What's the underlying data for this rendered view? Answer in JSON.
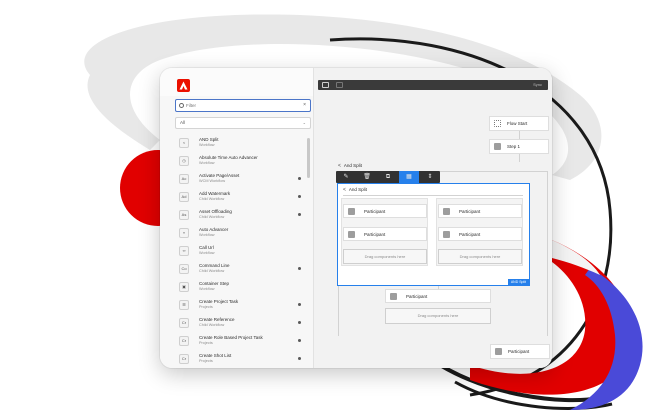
{
  "colors": {
    "accent": "#2680eb",
    "brand": "#eb1000",
    "backdrop_blue": "#4a4ad8",
    "backdrop_red": "#e10000"
  },
  "left_panel": {
    "filter_placeholder": "Filter",
    "filter_clear": "×",
    "select_value": "All",
    "components": [
      {
        "title": "AND Split",
        "subtitle": "Workflow",
        "icon": "split-icon",
        "icon_glyph": "<",
        "dot": false
      },
      {
        "title": "Absolute Time Auto Advancer",
        "subtitle": "Workflow",
        "icon": "clock-icon",
        "icon_glyph": "◷",
        "dot": false
      },
      {
        "title": "Activate Page/Asset",
        "subtitle": "WCM Workflow",
        "icon": "activate-icon",
        "icon_glyph": "Ac",
        "dot": true
      },
      {
        "title": "Add Watermark",
        "subtitle": "Child Workflow",
        "icon": "watermark-icon",
        "icon_glyph": "Ad",
        "dot": true
      },
      {
        "title": "Asset Offloading",
        "subtitle": "Child Workflow",
        "icon": "offload-icon",
        "icon_glyph": "As",
        "dot": true
      },
      {
        "title": "Auto Advancer",
        "subtitle": "Workflow",
        "icon": "advance-icon",
        "icon_glyph": "»",
        "dot": false
      },
      {
        "title": "Call Url",
        "subtitle": "Workflow",
        "icon": "link-icon",
        "icon_glyph": "∞",
        "dot": false
      },
      {
        "title": "Command Line",
        "subtitle": "Child Workflow",
        "icon": "command-icon",
        "icon_glyph": "Co",
        "dot": true
      },
      {
        "title": "Container Step",
        "subtitle": "Workflow",
        "icon": "container-icon",
        "icon_glyph": "▣",
        "dot": false
      },
      {
        "title": "Create Project Task",
        "subtitle": "Projects",
        "icon": "task-icon",
        "icon_glyph": "☰",
        "dot": true
      },
      {
        "title": "Create Reference",
        "subtitle": "Child Workflow",
        "icon": "reference-icon",
        "icon_glyph": "Cr",
        "dot": true
      },
      {
        "title": "Create Role Based Project Task",
        "subtitle": "Projects",
        "icon": "role-task-icon",
        "icon_glyph": "Cr",
        "dot": true
      },
      {
        "title": "Create Shot List",
        "subtitle": "Projects",
        "icon": "shot-list-icon",
        "icon_glyph": "Cr",
        "dot": true
      }
    ]
  },
  "canvas": {
    "toolbar_right_text": "Sync",
    "flow_start": "Flow Start",
    "step1": "Step 1",
    "outer_split_title": "And Split",
    "selected_split_title": "And Split",
    "participant": "Participant",
    "drag_placeholder": "Drag components here",
    "selected_tag": "AND Split",
    "toolbar_buttons": [
      {
        "name": "configure-icon",
        "glyph": "✎"
      },
      {
        "name": "delete-icon",
        "glyph": "🗑"
      },
      {
        "name": "copy-icon",
        "glyph": "⧉"
      },
      {
        "name": "group-icon",
        "glyph": "▦"
      },
      {
        "name": "reorder-icon",
        "glyph": "⇕"
      }
    ]
  }
}
